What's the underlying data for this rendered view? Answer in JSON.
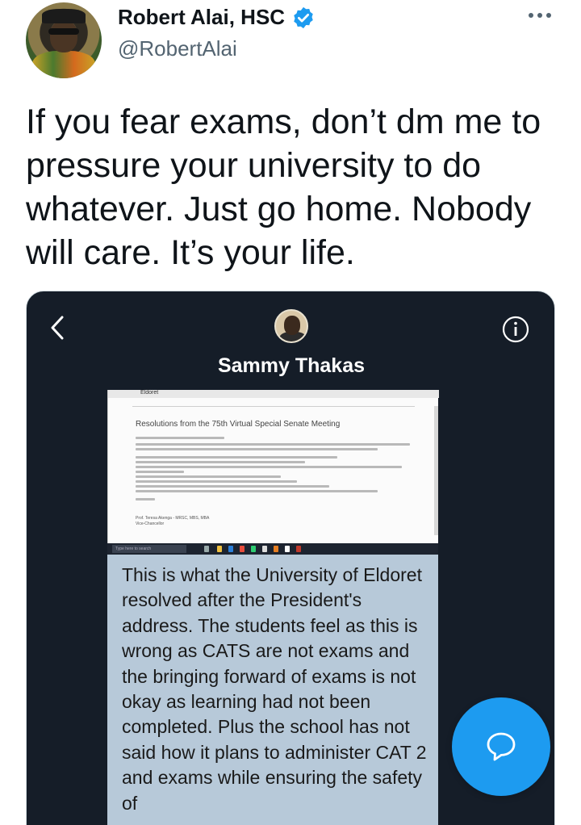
{
  "author": {
    "name": "Robert Alai, HSC",
    "handle": "@RobertAlai",
    "verified": true,
    "avatar_icon": "profile-avatar"
  },
  "tweet": {
    "text": "If you fear exams, don’t dm me to pressure your university to do whatever. Just go home. Nobody will care. It’s your life."
  },
  "media": {
    "chat_contact_name": "Sammy Thakas",
    "icons": [
      "back-chevron-icon",
      "info-icon"
    ],
    "document": {
      "logo": "Eldoret",
      "heading": "Resolutions from the 75th Virtual Special Senate Meeting",
      "signature": "Prof. Teresa Akenga - MRSC, MBS, MBA",
      "signature_title": "Vice-Chancellor"
    },
    "taskbar_search": "Type here to search",
    "message_text": "This is what the University of Eldoret  resolved after the President's address. The students feel as this is wrong as CATS are not exams and the bringing forward of exams is not okay as learning had not been completed. Plus the school has not said how it plans to administer CAT 2 and exams while ensuring the safety of"
  },
  "compose_button_icon": "compose-reply-icon",
  "colors": {
    "accent": "#1d9bf0",
    "media_bg": "#151d28",
    "bubble_bg": "#b7c9d9",
    "handle_gray": "#536471"
  }
}
